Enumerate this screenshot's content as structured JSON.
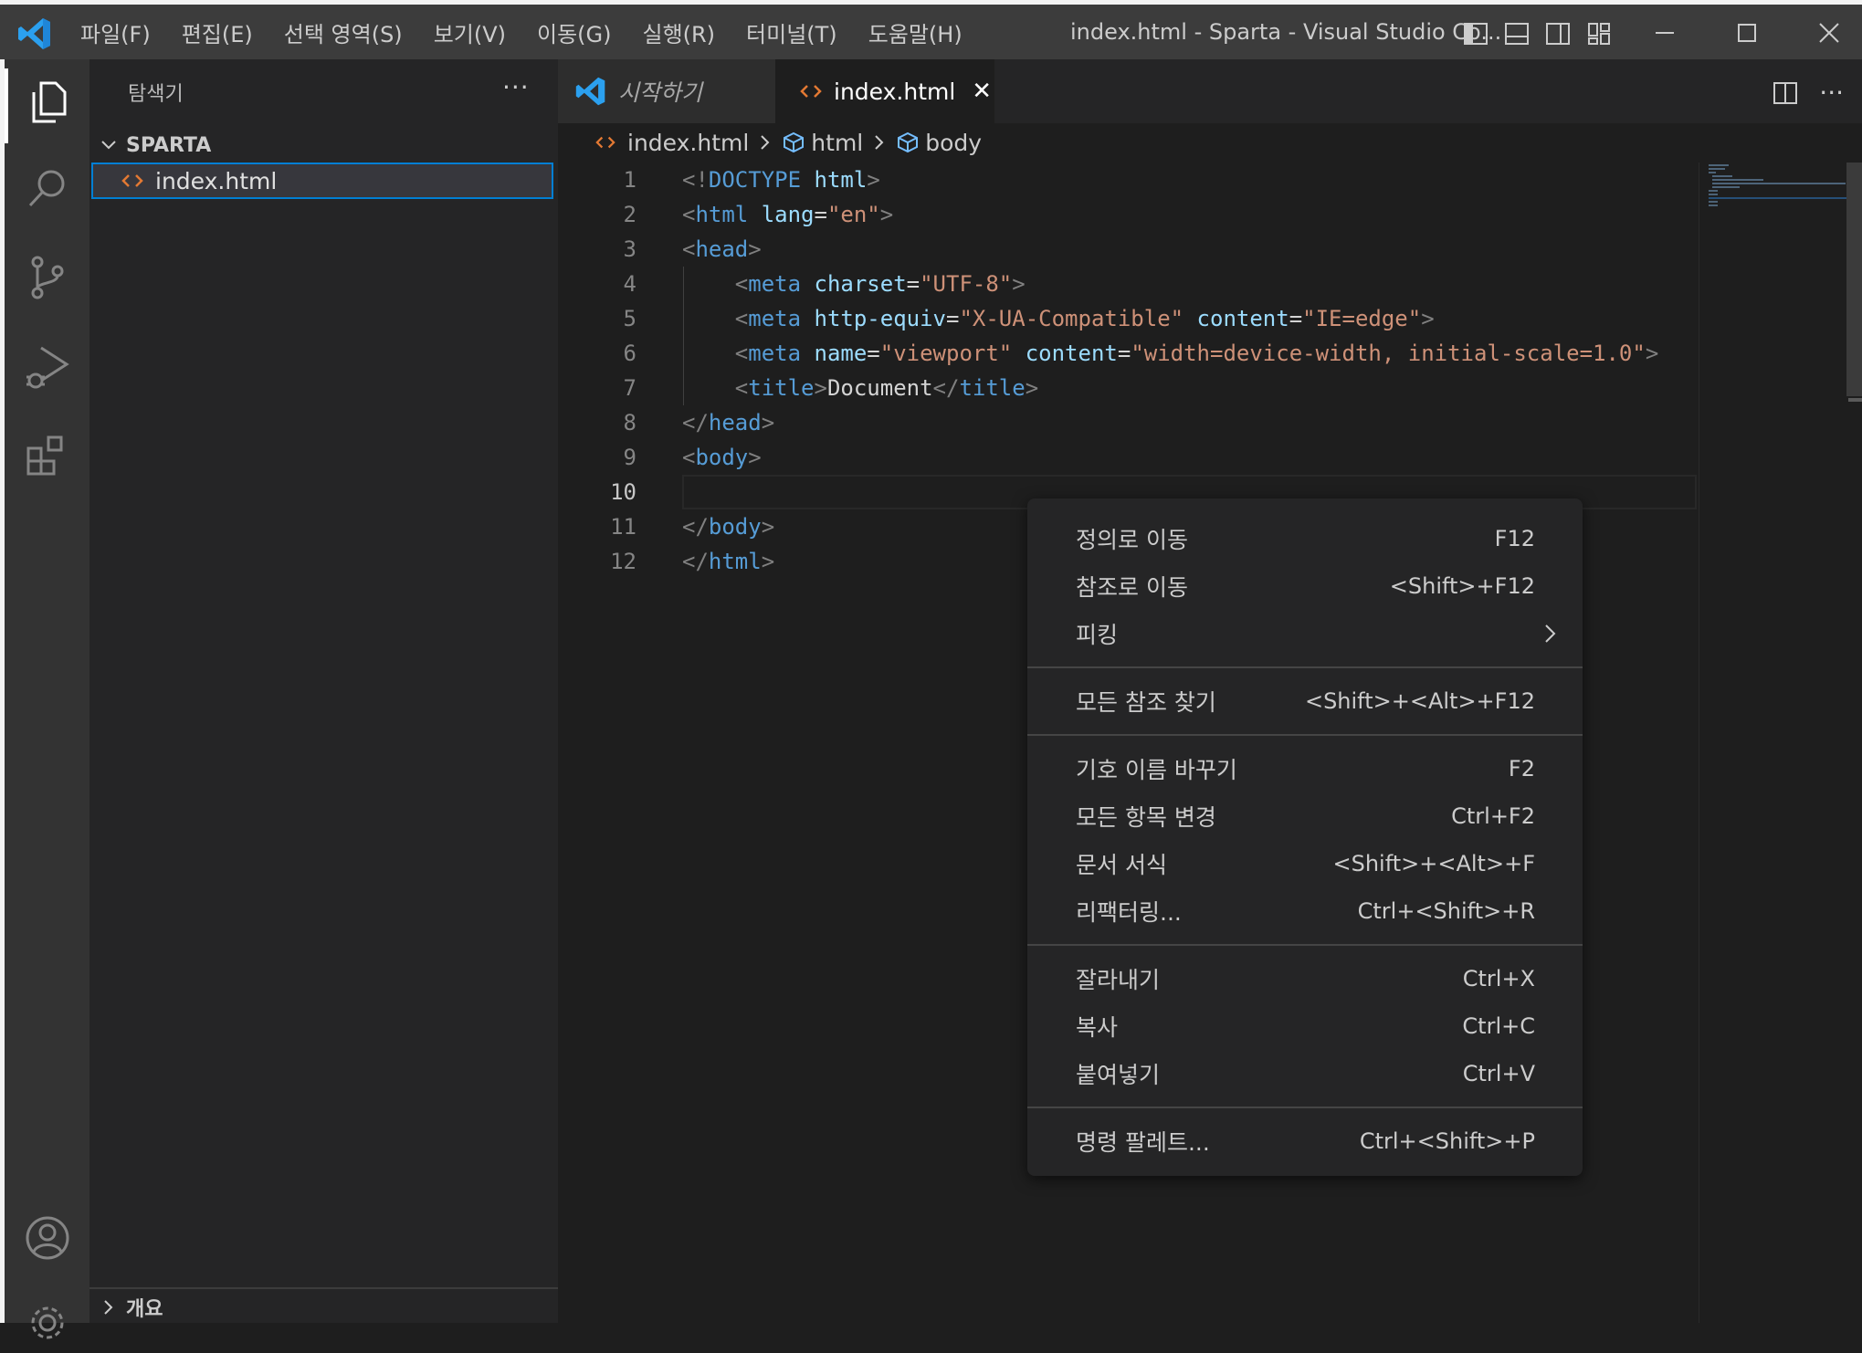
{
  "window": {
    "title": "index.html - Sparta - Visual Studio Co...",
    "menu": [
      "파일(F)",
      "편집(E)",
      "선택 영역(S)",
      "보기(V)",
      "이동(G)",
      "실행(R)",
      "터미널(T)",
      "도움말(H)"
    ]
  },
  "sidebar": {
    "title": "탐색기",
    "more": "···",
    "folder": "SPARTA",
    "file": "index.html",
    "outline": "개요"
  },
  "tabs": [
    {
      "label": "시작하기"
    },
    {
      "label": "index.html",
      "close": "✕"
    }
  ],
  "breadcrumb": [
    "index.html",
    "html",
    "body"
  ],
  "editor": {
    "more": "···",
    "lines": [
      {
        "n": "1",
        "tokens": [
          [
            "p",
            "<!"
          ],
          [
            "t",
            "DOCTYPE"
          ],
          [
            "x",
            " "
          ],
          [
            "a",
            "html"
          ],
          [
            "p",
            ">"
          ]
        ]
      },
      {
        "n": "2",
        "tokens": [
          [
            "p",
            "<"
          ],
          [
            "t",
            "html"
          ],
          [
            "x",
            " "
          ],
          [
            "a",
            "lang"
          ],
          [
            "x",
            "="
          ],
          [
            "s",
            "\"en\""
          ],
          [
            "p",
            ">"
          ]
        ]
      },
      {
        "n": "3",
        "tokens": [
          [
            "p",
            "<"
          ],
          [
            "t",
            "head"
          ],
          [
            "p",
            ">"
          ]
        ]
      },
      {
        "n": "4",
        "tokens": [
          [
            "x",
            "    "
          ],
          [
            "p",
            "<"
          ],
          [
            "t",
            "meta"
          ],
          [
            "x",
            " "
          ],
          [
            "a",
            "charset"
          ],
          [
            "x",
            "="
          ],
          [
            "s",
            "\"UTF-8\""
          ],
          [
            "p",
            ">"
          ]
        ]
      },
      {
        "n": "5",
        "tokens": [
          [
            "x",
            "    "
          ],
          [
            "p",
            "<"
          ],
          [
            "t",
            "meta"
          ],
          [
            "x",
            " "
          ],
          [
            "a",
            "http-equiv"
          ],
          [
            "x",
            "="
          ],
          [
            "s",
            "\"X-UA-Compatible\""
          ],
          [
            "x",
            " "
          ],
          [
            "a",
            "content"
          ],
          [
            "x",
            "="
          ],
          [
            "s",
            "\"IE=edge\""
          ],
          [
            "p",
            ">"
          ]
        ]
      },
      {
        "n": "6",
        "tokens": [
          [
            "x",
            "    "
          ],
          [
            "p",
            "<"
          ],
          [
            "t",
            "meta"
          ],
          [
            "x",
            " "
          ],
          [
            "a",
            "name"
          ],
          [
            "x",
            "="
          ],
          [
            "s",
            "\"viewport\""
          ],
          [
            "x",
            " "
          ],
          [
            "a",
            "content"
          ],
          [
            "x",
            "="
          ],
          [
            "s",
            "\"width=device-width, initial-scale=1.0\""
          ],
          [
            "p",
            ">"
          ]
        ]
      },
      {
        "n": "7",
        "tokens": [
          [
            "x",
            "    "
          ],
          [
            "p",
            "<"
          ],
          [
            "t",
            "title"
          ],
          [
            "p",
            ">"
          ],
          [
            "x",
            "Document"
          ],
          [
            "p",
            "</"
          ],
          [
            "t",
            "title"
          ],
          [
            "p",
            ">"
          ]
        ]
      },
      {
        "n": "8",
        "tokens": [
          [
            "p",
            "</"
          ],
          [
            "t",
            "head"
          ],
          [
            "p",
            ">"
          ]
        ]
      },
      {
        "n": "9",
        "tokens": [
          [
            "p",
            "<"
          ],
          [
            "t",
            "body"
          ],
          [
            "p",
            ">"
          ]
        ]
      },
      {
        "n": "10",
        "tokens": []
      },
      {
        "n": "11",
        "tokens": [
          [
            "p",
            "</"
          ],
          [
            "t",
            "body"
          ],
          [
            "p",
            ">"
          ]
        ]
      },
      {
        "n": "12",
        "tokens": [
          [
            "p",
            "</"
          ],
          [
            "t",
            "html"
          ],
          [
            "p",
            ">"
          ]
        ]
      }
    ],
    "active_line": "10"
  },
  "context_menu": {
    "groups": [
      [
        {
          "label": "정의로 이동",
          "key": "F12"
        },
        {
          "label": "참조로 이동",
          "key": "<Shift>+F12"
        },
        {
          "label": "피킹",
          "key": "",
          "submenu": true
        }
      ],
      [
        {
          "label": "모든 참조 찾기",
          "key": "<Shift>+<Alt>+F12"
        }
      ],
      [
        {
          "label": "기호 이름 바꾸기",
          "key": "F2"
        },
        {
          "label": "모든 항목 변경",
          "key": "Ctrl+F2"
        },
        {
          "label": "문서 서식",
          "key": "<Shift>+<Alt>+F"
        },
        {
          "label": "리팩터링...",
          "key": "Ctrl+<Shift>+R"
        }
      ],
      [
        {
          "label": "잘라내기",
          "key": "Ctrl+X"
        },
        {
          "label": "복사",
          "key": "Ctrl+C"
        },
        {
          "label": "붙여넣기",
          "key": "Ctrl+V"
        }
      ],
      [
        {
          "label": "명령 팔레트...",
          "key": "Ctrl+<Shift>+P"
        }
      ]
    ]
  },
  "colors": {
    "accent": "#007acc",
    "html_icon": "#e37933",
    "activity_icon": "#858585"
  }
}
